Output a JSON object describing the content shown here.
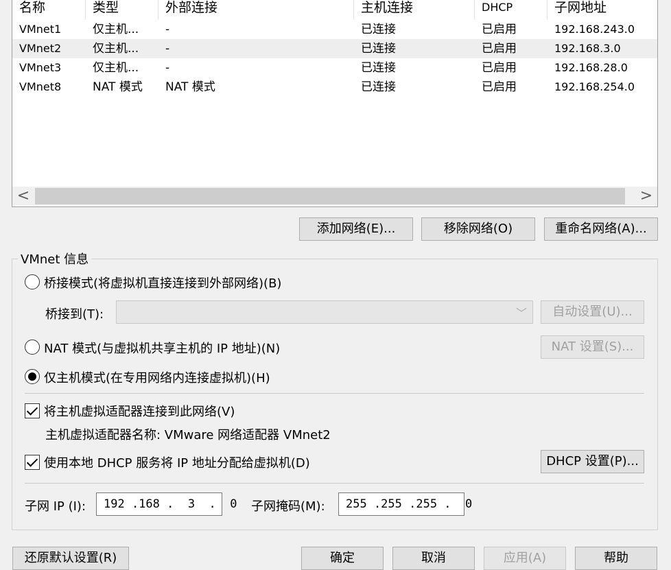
{
  "table": {
    "columns": [
      "名称",
      "类型",
      "外部连接",
      "主机连接",
      "DHCP",
      "子网地址"
    ],
    "rows": [
      {
        "name": "VMnet1",
        "type": "仅主机...",
        "external": "-",
        "host": "已连接",
        "dhcp": "已启用",
        "subnet": "192.168.243.0"
      },
      {
        "name": "VMnet2",
        "type": "仅主机...",
        "external": "-",
        "host": "已连接",
        "dhcp": "已启用",
        "subnet": "192.168.3.0"
      },
      {
        "name": "VMnet3",
        "type": "仅主机...",
        "external": "-",
        "host": "已连接",
        "dhcp": "已启用",
        "subnet": "192.168.28.0"
      },
      {
        "name": "VMnet8",
        "type": "NAT 模式",
        "external": "NAT 模式",
        "host": "已连接",
        "dhcp": "已启用",
        "subnet": "192.168.254.0"
      }
    ],
    "scroll_left": "<",
    "scroll_right": ">"
  },
  "network_buttons": {
    "add": "添加网络(E)...",
    "remove": "移除网络(O)",
    "rename": "重命名网络(A)..."
  },
  "vmnet_info": {
    "title": "VMnet 信息",
    "bridged_label": "桥接模式(将虚拟机直接连接到外部网络)(B)",
    "bridge_to_label": "桥接到(T):",
    "bridge_to_value": "",
    "auto_settings": "自动设置(U)...",
    "nat_label": "NAT 模式(与虚拟机共享主机的 IP 地址)(N)",
    "nat_settings": "NAT 设置(S)...",
    "hostonly_label": "仅主机模式(在专用网络内连接虚拟机)(H)",
    "connect_adapter_label": "将主机虚拟适配器连接到此网络(V)",
    "adapter_name_label": "主机虚拟适配器名称: VMware 网络适配器 VMnet2",
    "dhcp_label": "使用本地 DHCP 服务将 IP 地址分配给虚拟机(D)",
    "dhcp_settings": "DHCP 设置(P)...",
    "subnet_ip_label": "子网 IP (I):",
    "subnet_ip_value": "192 .168 .  3  .  0",
    "subnet_mask_label": "子网掩码(M):",
    "subnet_mask_value": "255 .255 .255 .  0"
  },
  "footer": {
    "restore": "还原默认设置(R)",
    "ok": "确定",
    "cancel": "取消",
    "apply": "应用(A)",
    "help": "帮助"
  },
  "colors": {
    "background": "#f0f0f0",
    "selected_row": "#eeeeee",
    "disabled_text": "#a0a0a0"
  }
}
